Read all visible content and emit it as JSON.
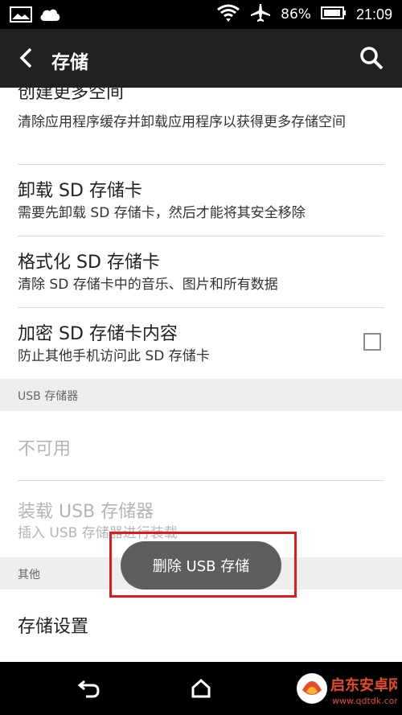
{
  "status_bar": {
    "battery_percent": "86%",
    "time": "21:09"
  },
  "app_bar": {
    "title": "存储"
  },
  "items": [
    {
      "title": "创建更多空间",
      "subtitle": "清除应用程序缓存并卸载应用程序以获得更多存储空间"
    },
    {
      "title": "卸载 SD 存储卡",
      "subtitle": "需要先卸载 SD 存储卡，然后才能将其安全移除"
    },
    {
      "title": "格式化 SD 存储卡",
      "subtitle": "清除 SD 存储卡中的音乐、图片和所有数据"
    },
    {
      "title": "加密 SD 存储卡内容",
      "subtitle": "防止其他手机访问此 SD 存储卡",
      "checked": false
    }
  ],
  "usb_section": {
    "header": "USB 存储器",
    "unavailable": "不可用",
    "mount_title": "装载 USB 存储器",
    "mount_subtitle": "插入 USB 存储器进行装载"
  },
  "other_section": {
    "header": "其他",
    "storage_settings": "存储设置"
  },
  "toast": {
    "text": "删除 USB 存储"
  },
  "watermark": {
    "name": "启东安卓网",
    "url": "www.qdtdk.com"
  },
  "colors": {
    "app_bar": "#212121",
    "highlight": "#e0191c",
    "toast": "#5e5e5e"
  }
}
